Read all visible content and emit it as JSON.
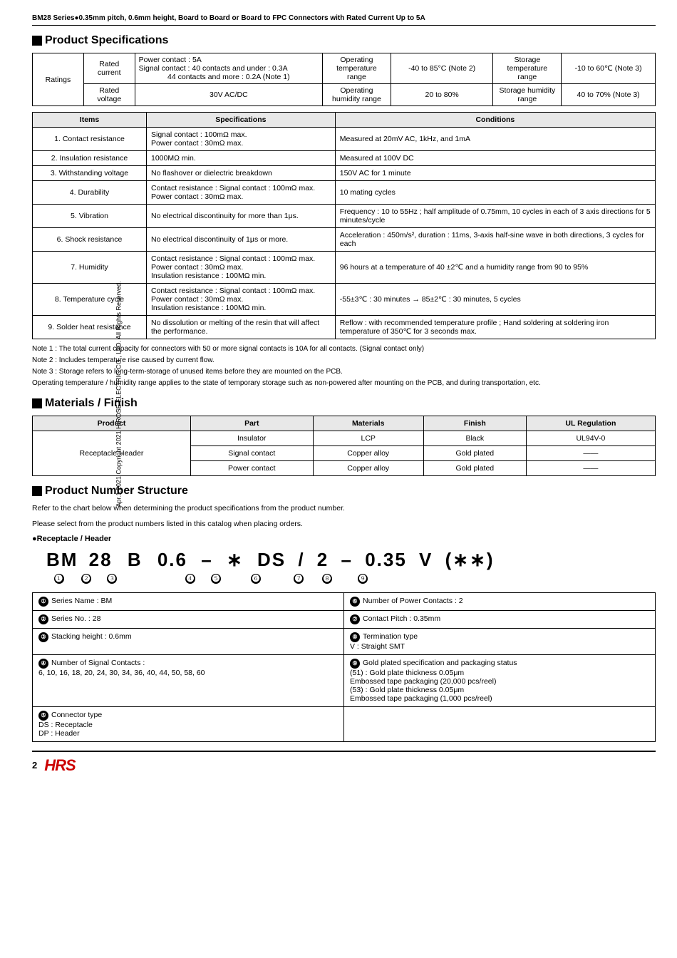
{
  "header": {
    "title": "BM28 Series●0.35mm pitch, 0.6mm height, Board to Board or Board to FPC Connectors with Rated Current Up to 5A"
  },
  "sidebar": {
    "text": "Apr.1.2021 Copyright 2021 HIROSE ELECTRIC CO., LTD. All Rights Reserved."
  },
  "product_specs": {
    "section_title": "Product Specifications",
    "ratings_table": {
      "rated_current_label": "Rated current",
      "rated_voltage_label": "Rated voltage",
      "power_contact": "Power contact : 5A",
      "signal_contact_40": "Signal contact : 40 contacts and under : 0.3A",
      "signal_contact_44": "44 contacts and more : 0.2A (Note 1)",
      "voltage_value": "30V AC/DC",
      "op_temp_label": "Operating temperature range",
      "op_temp_value": "-40 to 85°C (Note 2)",
      "storage_temp_label": "Storage temperature range",
      "storage_temp_value": "-10 to 60℃ (Note 3)",
      "op_humidity_label": "Operating humidity range",
      "op_humidity_value": "20 to 80%",
      "storage_humidity_label": "Storage humidity range",
      "storage_humidity_value": "40 to 70% (Note 3)"
    },
    "items_header": "Items",
    "conditions_header": "Conditions",
    "rows": [
      {
        "item": "1. Contact resistance",
        "spec": "Signal contact : 100mΩ max.\nPower contact : 30mΩ max.",
        "condition": "Measured at 20mV AC, 1kHz, and 1mA"
      },
      {
        "item": "2. Insulation resistance",
        "spec": "1000MΩ min.",
        "condition": "Measured at 100V DC"
      },
      {
        "item": "3. Withstanding voltage",
        "spec": "No flashover or dielectric breakdown",
        "condition": "150V AC for 1 minute"
      },
      {
        "item": "4. Durability",
        "spec": "Contact resistance : Signal contact : 100mΩ max.\nPower contact : 30mΩ max.",
        "condition": "10 mating cycles"
      },
      {
        "item": "5. Vibration",
        "spec": "No electrical discontinuity for more than 1μs.",
        "condition": "Frequency : 10 to 55Hz ; half amplitude of 0.75mm, 10 cycles in each of 3 axis directions for 5 minutes/cycle"
      },
      {
        "item": "6. Shock resistance",
        "spec": "No electrical discontinuity of 1μs or more.",
        "condition": "Acceleration : 450m/s², duration : 11ms, 3-axis half-sine wave in both directions, 3 cycles for each"
      },
      {
        "item": "7. Humidity",
        "spec": "Contact resistance : Signal contact : 100mΩ max.\nPower contact : 30mΩ max.\nInsulation resistance : 100MΩ min.",
        "condition": "96 hours at a temperature of 40 ±2℃ and a humidity range from 90 to 95%"
      },
      {
        "item": "8. Temperature cycle",
        "spec": "Contact resistance : Signal contact : 100mΩ max.\nPower contact : 30mΩ max.\nInsulation resistance : 100MΩ min.",
        "condition": "-55±3℃ : 30 minutes → 85±2℃ : 30 minutes, 5 cycles"
      },
      {
        "item": "9. Solder heat resistance",
        "spec": "No dissolution or melting of the resin that will affect the performance.",
        "condition": "Reflow : with recommended temperature profile ; Hand soldering at soldering iron temperature of 350℃ for 3 seconds max."
      }
    ],
    "notes": [
      "Note 1 : The total current capacity for connectors with 50 or more signal contacts is 10A for all contacts. (Signal contact only)",
      "Note 2 : Includes temperature rise caused by current flow.",
      "Note 3 : Storage refers to long-term-storage of unused items before they are mounted on the PCB.",
      "          Operating temperature / humidity range applies to the state of temporary storage such as non-powered after mounting on the PCB, and during transportation, etc."
    ]
  },
  "materials": {
    "section_title": "Materials / Finish",
    "columns": [
      "Product",
      "Part",
      "Materials",
      "Finish",
      "UL Regulation"
    ],
    "product_label": "Receptacle Header",
    "rows": [
      {
        "part": "Insulator",
        "material": "LCP",
        "finish": "Black",
        "ul": "UL94V-0"
      },
      {
        "part": "Signal contact",
        "material": "Copper alloy",
        "finish": "Gold plated",
        "ul": "——"
      },
      {
        "part": "Power contact",
        "material": "Copper alloy",
        "finish": "Gold plated",
        "ul": "——"
      }
    ]
  },
  "product_number": {
    "section_title": "Product Number Structure",
    "desc1": "Refer to the chart below when determining the product specifications from the product number.",
    "desc2": "Please select from the product numbers listed in this catalog when placing orders.",
    "receptacle_header": "●Receptacle / Header",
    "pn_display": "BM 28 B 0.6 – ∗ DS / 2 – 0.35 V (∗∗)",
    "segments": [
      {
        "text": "BM",
        "num": "1"
      },
      {
        "text": "28",
        "num": "2"
      },
      {
        "text": "B",
        "num": "3"
      },
      {
        "text": "0.6",
        "num": ""
      },
      {
        "text": "–",
        "num": ""
      },
      {
        "text": "∗",
        "num": "4"
      },
      {
        "text": "DS",
        "num": "5"
      },
      {
        "text": "/",
        "num": ""
      },
      {
        "text": "2",
        "num": "6"
      },
      {
        "text": "–",
        "num": ""
      },
      {
        "text": "0.35",
        "num": "7"
      },
      {
        "text": "V",
        "num": "8"
      },
      {
        "text": "(∗∗)",
        "num": "9"
      }
    ],
    "legend": [
      {
        "num": "1",
        "label": "Series Name : BM"
      },
      {
        "num": "6",
        "label": "Number of Power Contacts : 2"
      },
      {
        "num": "2",
        "label": "Series No. : 28"
      },
      {
        "num": "7",
        "label": "Contact Pitch : 0.35mm"
      },
      {
        "num": "3",
        "label": "Stacking height : 0.6mm"
      },
      {
        "num": "8",
        "label": "Termination type\nV : Straight SMT"
      },
      {
        "num": "4",
        "label": "Number of Signal Contacts :\n6, 10, 16, 18, 20, 24, 30, 34, 36, 40, 44, 50, 58, 60"
      },
      {
        "num": "9",
        "label": "Gold plated specification and packaging status\n(51) : Gold plate thickness 0.05μm\n       Embossed tape packaging (20,000 pcs/reel)\n(53) : Gold plate thickness 0.05μm\n       Embossed tape packaging (1,000 pcs/reel)"
      },
      {
        "num": "5",
        "label": "Connector type\nDS : Receptacle\nDP : Header"
      }
    ]
  },
  "footer": {
    "page_num": "2",
    "logo": "HRS"
  }
}
